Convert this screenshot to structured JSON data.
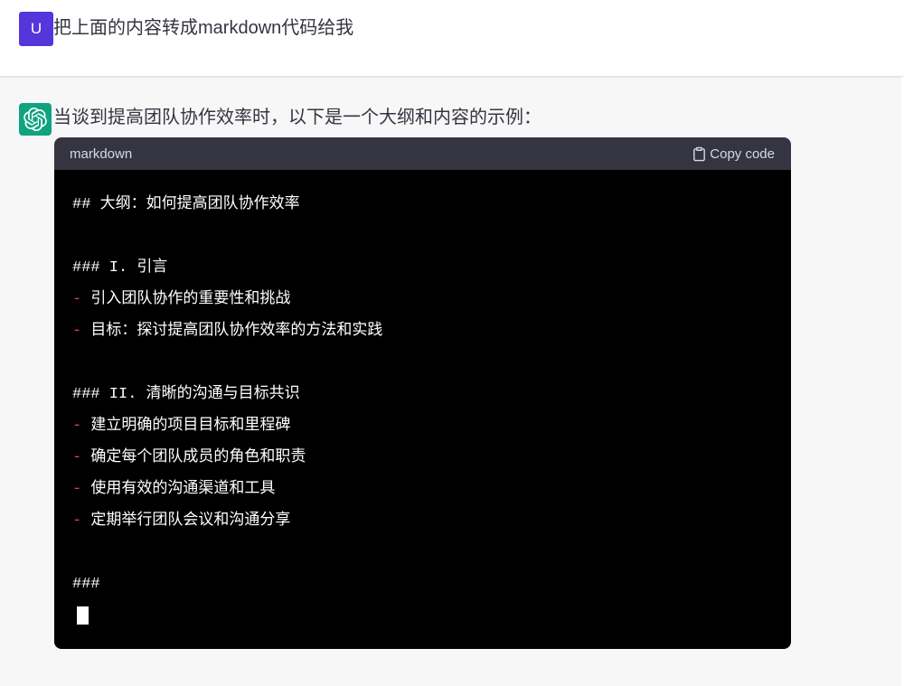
{
  "user_message": {
    "avatar_letter": "U",
    "text": "把上面的内容转成markdown代码给我"
  },
  "assistant_message": {
    "avatar": "chatgpt-logo",
    "intro": "当谈到提高团队协作效率时，以下是一个大纲和内容的示例："
  },
  "code_block": {
    "language_label": "markdown",
    "copy_button_label": "Copy code",
    "copy_icon": "clipboard-icon",
    "lines": [
      {
        "type": "heading",
        "marker": "##",
        "text": "大纲：如何提高团队协作效率"
      },
      {
        "type": "blank"
      },
      {
        "type": "heading",
        "marker": "###",
        "text": "I. 引言"
      },
      {
        "type": "bullet",
        "marker": "-",
        "text": "引入团队协作的重要性和挑战"
      },
      {
        "type": "bullet",
        "marker": "-",
        "text": "目标：探讨提高团队协作效率的方法和实践"
      },
      {
        "type": "blank"
      },
      {
        "type": "heading",
        "marker": "###",
        "text": "II. 清晰的沟通与目标共识"
      },
      {
        "type": "bullet",
        "marker": "-",
        "text": "建立明确的项目目标和里程碑"
      },
      {
        "type": "bullet",
        "marker": "-",
        "text": "确定每个团队成员的角色和职责"
      },
      {
        "type": "bullet",
        "marker": "-",
        "text": "使用有效的沟通渠道和工具"
      },
      {
        "type": "bullet",
        "marker": "-",
        "text": "定期举行团队会议和沟通分享"
      },
      {
        "type": "blank"
      },
      {
        "type": "heading",
        "marker": "###",
        "text": ""
      },
      {
        "type": "cursor"
      }
    ]
  },
  "colors": {
    "user_avatar_bg": "#5436da",
    "assistant_avatar_bg": "#10a37f",
    "code_header_bg": "#343541",
    "code_header_text": "#d9d9e3",
    "code_body_bg": "#000000",
    "code_text": "#ffffff",
    "bullet_red": "#e2444f",
    "section_bg": "#f7f7f8",
    "message_text": "#343541",
    "divider": "#e6e6e9"
  }
}
